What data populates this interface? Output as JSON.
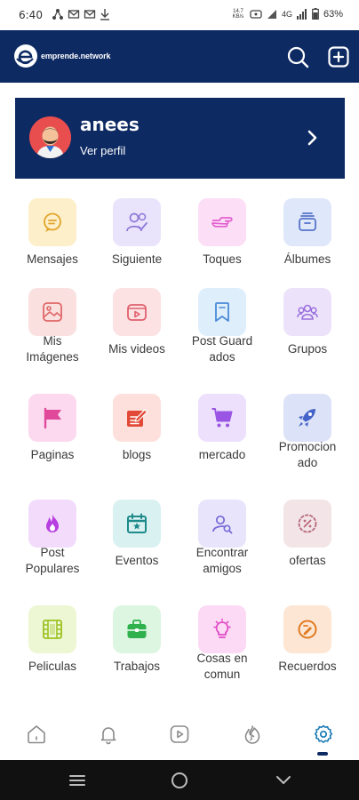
{
  "status_bar": {
    "time": "6:40",
    "network_speed": "14.7 KB/s",
    "network_type": "4G",
    "battery": "63%"
  },
  "header": {
    "logo_text": "emprende.network",
    "icons": [
      "search-icon",
      "add-icon"
    ]
  },
  "profile": {
    "name": "anees",
    "subtitle": "Ver perfil"
  },
  "menu": {
    "items": [
      {
        "label": "Mensajes",
        "icon": "chat-icon",
        "bg": "#fdefc9",
        "fg": "#e2a52a"
      },
      {
        "label": "Siguiente",
        "icon": "user-check-icon",
        "bg": "#e9e4fb",
        "fg": "#8c78d8"
      },
      {
        "label": "Toques",
        "icon": "poke-hand-icon",
        "bg": "#fcdff6",
        "fg": "#e25ed0"
      },
      {
        "label": "Álbumes",
        "icon": "album-icon",
        "bg": "#dfe7fb",
        "fg": "#5674c9"
      },
      {
        "label": "Mis Imágenes",
        "icon": "image-icon",
        "bg": "#fbe0e0",
        "fg": "#e06868"
      },
      {
        "label": "Mis videos",
        "icon": "video-icon",
        "bg": "#fde2e4",
        "fg": "#e0606c"
      },
      {
        "label": "Post Guardados",
        "icon": "bookmark-icon",
        "bg": "#dfeefb",
        "fg": "#4a8bd8"
      },
      {
        "label": "Grupos",
        "icon": "group-icon",
        "bg": "#ece3fb",
        "fg": "#9a6fdc"
      },
      {
        "label": "Paginas",
        "icon": "flag-icon",
        "bg": "#fcd9ef",
        "fg": "#e0489a"
      },
      {
        "label": "blogs",
        "icon": "blog-edit-icon",
        "bg": "#fde0dc",
        "fg": "#e24a37"
      },
      {
        "label": "mercado",
        "icon": "cart-icon",
        "bg": "#ece0fc",
        "fg": "#9a55e4"
      },
      {
        "label": "Promocionado",
        "icon": "rocket-icon",
        "bg": "#dce2f7",
        "fg": "#4564c9"
      },
      {
        "label": "Post Populares",
        "icon": "fire-icon",
        "bg": "#f3dcfb",
        "fg": "#b73ee0"
      },
      {
        "label": "Eventos",
        "icon": "calendar-icon",
        "bg": "#d9f1f1",
        "fg": "#1e8a8a"
      },
      {
        "label": "Encontrar amigos",
        "icon": "search-user-icon",
        "bg": "#e8e4fb",
        "fg": "#7469d6"
      },
      {
        "label": "ofertas",
        "icon": "offer-badge-icon",
        "bg": "#f2e4e7",
        "fg": "#b76779"
      },
      {
        "label": "Peliculas",
        "icon": "film-icon",
        "bg": "#eef7d4",
        "fg": "#9cc121"
      },
      {
        "label": "Trabajos",
        "icon": "briefcase-icon",
        "bg": "#dcf6e1",
        "fg": "#2fb24d"
      },
      {
        "label": "Cosas en comun",
        "icon": "lightbulb-icon",
        "bg": "#fcdaf5",
        "fg": "#e04ac6"
      },
      {
        "label": "Recuerdos",
        "icon": "memories-icon",
        "bg": "#fde6d4",
        "fg": "#e07a20"
      }
    ],
    "label_lines": [
      [
        "Mensajes"
      ],
      [
        "Siguiente"
      ],
      [
        "Toques"
      ],
      [
        "Álbumes"
      ],
      [
        "Mis",
        "Imágenes"
      ],
      [
        "Mis videos"
      ],
      [
        "Post Guard",
        "ados"
      ],
      [
        "Grupos"
      ],
      [
        "Paginas"
      ],
      [
        "blogs"
      ],
      [
        "mercado"
      ],
      [
        "Promocion",
        "ado"
      ],
      [
        "Post",
        "Populares"
      ],
      [
        "Eventos"
      ],
      [
        "Encontrar",
        "amigos"
      ],
      [
        "ofertas"
      ],
      [
        "Peliculas"
      ],
      [
        "Trabajos"
      ],
      [
        "Cosas en",
        "comun"
      ],
      [
        "Recuerdos"
      ]
    ]
  },
  "bottom_nav": {
    "items": [
      "home-icon",
      "notification-bell-icon",
      "video-play-icon",
      "trending-icon",
      "settings-icon"
    ],
    "active": "settings-icon",
    "active_color": "#1a7bb5"
  },
  "system_nav": {
    "items": [
      "recent-apps-icon",
      "home-circle-icon",
      "back-chevron-icon"
    ]
  }
}
